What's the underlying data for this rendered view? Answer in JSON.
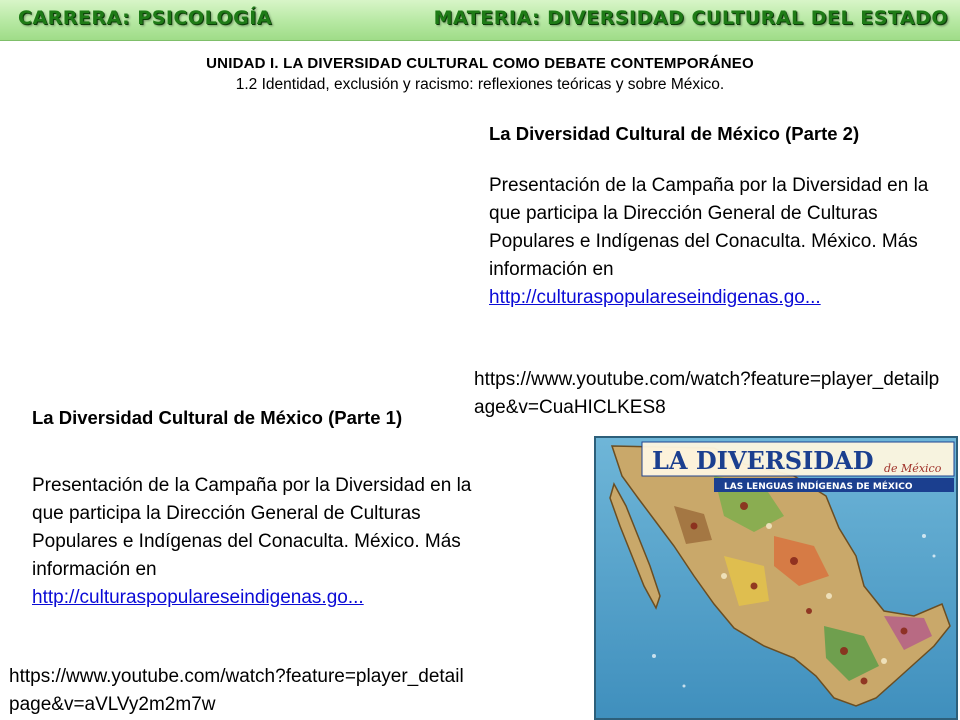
{
  "header": {
    "career": "CARRERA: PSICOLOGÍA",
    "subject": "MATERIA: DIVERSIDAD CULTURAL DEL ESTADO"
  },
  "unit": {
    "title": "UNIDAD I. LA DIVERSIDAD  CULTURAL COMO DEBATE CONTEMPORÁNEO",
    "subtitle": "1.2 Identidad, exclusión y racismo: reflexiones teóricas y sobre México."
  },
  "video_part2": {
    "title": "La Diversidad Cultural de México (Parte 2)",
    "description": "Presentación de la Campaña por la Diversidad en la que participa la Dirección General de Culturas Populares e Indígenas del Conaculta. México. Más información en",
    "more_link": "http://culturaspopulareseindigenas.go...",
    "youtube_url": "https://www.youtube.com/watch?feature=player_detailpage&v=CuaHICLKES8"
  },
  "video_part1": {
    "title": "La Diversidad Cultural de México (Parte 1)",
    "description": "Presentación de la Campaña por la Diversidad en la que participa la Dirección General de Culturas Populares e Indígenas del Conaculta. México. Más información en",
    "more_link": "http://culturaspopulareseindigenas.go...",
    "youtube_url": "https://www.youtube.com/watch?feature=player_detailpage&v=aVLVy2m2m7w"
  },
  "map_poster": {
    "title": "LA DIVERSIDAD",
    "title_small": "de México",
    "subtitle": "LAS LENGUAS INDÍGENAS DE MÉXICO"
  },
  "colors": {
    "banner_text": "#1e7b16",
    "link": "#0b0bd6",
    "map_sea": "#5aa8cf",
    "map_title": "#1b3f8f"
  }
}
